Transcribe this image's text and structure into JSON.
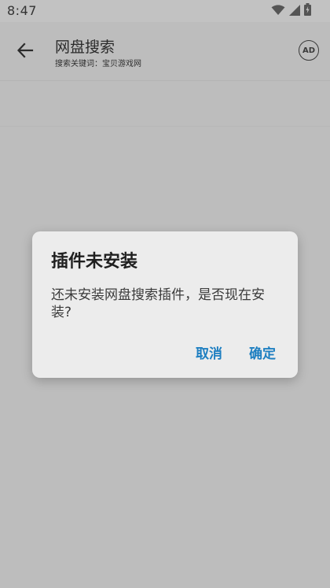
{
  "status_bar": {
    "time": "8:47"
  },
  "app_bar": {
    "title": "网盘搜索",
    "subtitle": "搜索关键词：宝贝游戏网",
    "ad_label": "AD"
  },
  "dialog": {
    "title": "插件未安装",
    "message": "还未安装网盘搜索插件，是否现在安装?",
    "cancel_label": "取消",
    "confirm_label": "确定"
  },
  "colors": {
    "accent": "#1e7fc1",
    "scrim_background": "#bdbdbd",
    "dialog_background": "#ececec"
  }
}
